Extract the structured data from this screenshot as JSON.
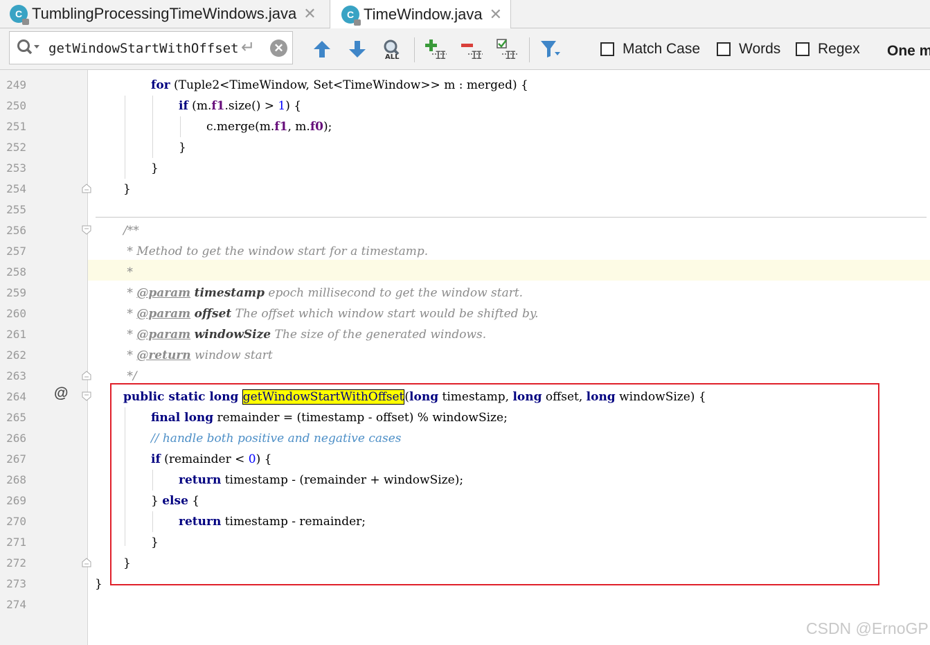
{
  "tabs": [
    {
      "label": "TumblingProcessingTimeWindows.java",
      "icon": "java-class-icon",
      "icon_letter": "C",
      "active": false
    },
    {
      "label": "TimeWindow.java",
      "icon": "java-class-icon",
      "icon_letter": "C",
      "active": true
    }
  ],
  "search": {
    "query": "getWindowStartWithOffset",
    "options": [
      {
        "label": "Match Case",
        "checked": false
      },
      {
        "label": "Words",
        "checked": false
      },
      {
        "label": "Regex",
        "checked": false
      }
    ],
    "result_label": "One m"
  },
  "toolbar_icons": [
    "arrow-up-icon",
    "arrow-down-icon",
    "find-all-icon",
    "add-occurrence-icon",
    "remove-occurrence-icon",
    "select-all-occurrences-icon",
    "filter-icon"
  ],
  "colors": {
    "keyword": "#000080",
    "number": "#0000ff",
    "field": "#660e7a",
    "doc_comment": "#8c8c8c",
    "line_comment": "#4d8fc7",
    "search_hit": "#ffff00",
    "annotation_box": "#e0202a",
    "caret_row": "#fdfbe5"
  },
  "editor": {
    "line_numbers": [
      "249",
      "250",
      "251",
      "252",
      "253",
      "254",
      "255",
      "256",
      "257",
      "258",
      "259",
      "260",
      "261",
      "262",
      "263",
      "264",
      "265",
      "266",
      "267",
      "268",
      "269",
      "270",
      "271",
      "272",
      "273",
      "274"
    ],
    "current_line": "258",
    "gutter_marker": "@",
    "tokens": {
      "for": "for",
      "l249_a": " (Tuple2<TimeWindow, Set<TimeWindow>> m : merged) {",
      "if": "if",
      "l250_a": " (m.",
      "f1": "f1",
      "l250_b": ".size() > ",
      "one": "1",
      "l250_c": ") {",
      "l251_a": "c.merge(m.",
      "l251_b": ", m.",
      "f0": "f0",
      "l251_c": ");",
      "close_brace": "}",
      "doc_open": "/**",
      "doc_method": " * Method to get the window start for a timestamp.",
      "doc_star": " *",
      "doc_star_prefix": " * ",
      "param": "@param",
      "return": "@return",
      "p_timestamp": "timestamp",
      "p_timestamp_desc": " epoch millisecond to get the window start.",
      "p_offset": "offset",
      "p_offset_desc": " The offset which window start would be shifted by.",
      "p_windowSize": "windowSize",
      "p_windowSize_desc": " The size of the generated windows.",
      "return_desc": " window start",
      "doc_close": " */",
      "public_static_long": "public static long",
      "method_name": "getWindowStartWithOffset",
      "open_paren": "(",
      "long": "long",
      "sig_timestamp": " timestamp, ",
      "sig_offset": " offset, ",
      "sig_windowSize": " windowSize) {",
      "final_long": "final long",
      "l265_a": " remainder = (timestamp - offset) % windowSize;",
      "l266_comment": "// handle both positive and negative cases",
      "l267_a": " (remainder < ",
      "zero": "0",
      "l267_b": ") {",
      "return_kw": "return",
      "l268_a": " timestamp - (remainder + windowSize);",
      "close_brace_sp": "} ",
      "else": "else",
      "l269_a": " {",
      "l270_a": " timestamp - remainder;"
    }
  },
  "watermark": "CSDN @ErnoGP"
}
